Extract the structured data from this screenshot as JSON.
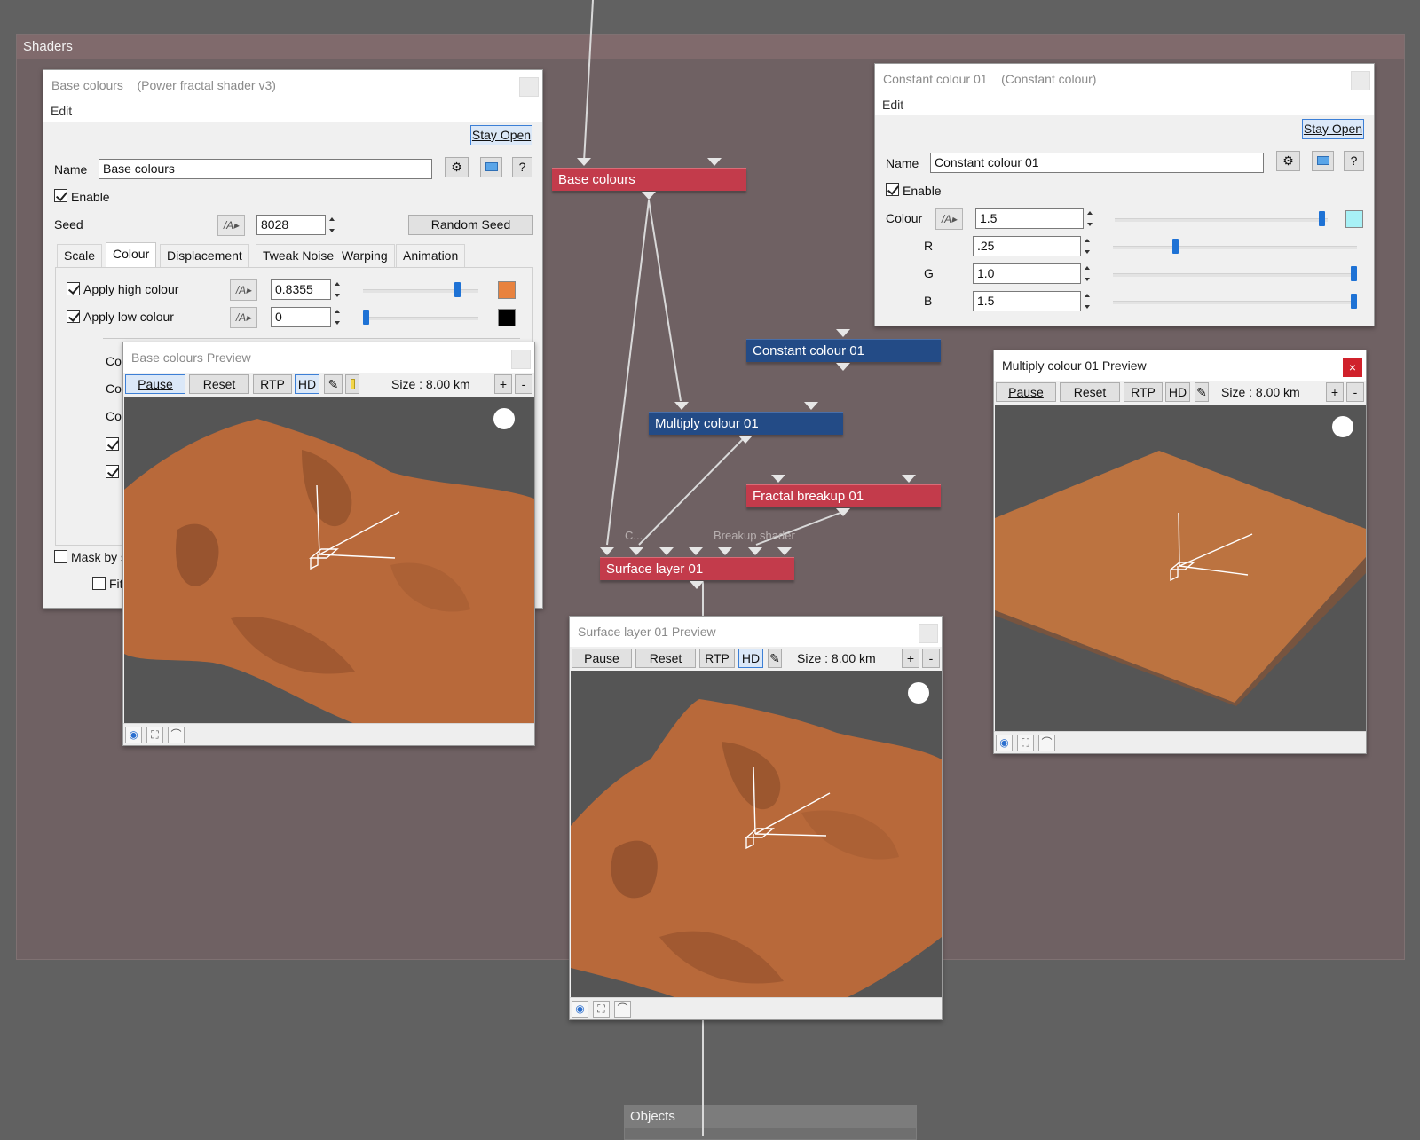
{
  "shaders_group": {
    "title": "Shaders"
  },
  "objects_group": {
    "title": "Objects"
  },
  "nodes": {
    "base_colours": "Base colours",
    "constant_colour": "Constant colour 01",
    "multiply_colour": "Multiply colour 01",
    "fractal_breakup": "Fractal breakup 01",
    "surface_layer": "Surface layer 01",
    "surface_input_c": "C...",
    "surface_input_breakup": "Breakup shader"
  },
  "base_colours_window": {
    "title": "Base colours",
    "type": "(Power fractal shader v3)",
    "menu_edit": "Edit",
    "stay_open": "Stay Open",
    "name_label": "Name",
    "name_value": "Base colours",
    "gear_icon": "gear-icon",
    "help": "?",
    "enable": "Enable",
    "seed_label": "Seed",
    "seed_value": "8028",
    "random_seed": "Random Seed",
    "tabs": [
      "Scale",
      "Colour",
      "Displacement",
      "Tweak Noise",
      "Warping",
      "Animation"
    ],
    "apply_high_colour": "Apply high colour",
    "high_colour_value": "0.8355",
    "high_colour_level": 0.8355,
    "high_colour_swatch": "#e8823e",
    "apply_low_colour": "Apply low colour",
    "low_colour_value": "0",
    "low_colour_level": 0,
    "low_colour_swatch": "#000000",
    "partial_rows": [
      "Col",
      "Col",
      "Col"
    ],
    "mask_by": "Mask by s",
    "fit": "Fit"
  },
  "base_colours_preview": {
    "title": "Base colours Preview",
    "pause": "Pause",
    "reset": "Reset",
    "rtp": "RTP",
    "hd": "HD",
    "size": "Size :  8.00 km",
    "plus": "+",
    "minus": "-"
  },
  "constant_colour_window": {
    "title": "Constant colour 01",
    "type": "(Constant colour)",
    "menu_edit": "Edit",
    "stay_open": "Stay Open",
    "name_label": "Name",
    "name_value": "Constant colour 01",
    "help": "?",
    "enable": "Enable",
    "colour_label": "Colour",
    "colour_value": "1.5",
    "colour_swatch": "#a8f1f6",
    "r_label": "R",
    "r_value": ".25",
    "r_level": 0.25,
    "g_label": "G",
    "g_value": "1.0",
    "g_level": 1.0,
    "b_label": "B",
    "b_value": "1.5",
    "b_level": 1.0
  },
  "multiply_preview": {
    "title": "Multiply colour 01 Preview",
    "close": "×",
    "pause": "Pause",
    "reset": "Reset",
    "rtp": "RTP",
    "hd": "HD",
    "size": "Size :  8.00 km",
    "plus": "+",
    "minus": "-"
  },
  "surface_preview": {
    "title": "Surface layer 01 Preview",
    "pause": "Pause",
    "reset": "Reset",
    "rtp": "RTP",
    "hd": "HD",
    "size": "Size :  8.00 km",
    "plus": "+",
    "minus": "-"
  },
  "colors": {
    "node_red": "#c33b4b",
    "node_blue": "#234b86",
    "terrain": "#b8693a",
    "accent": "#1e72d5"
  }
}
